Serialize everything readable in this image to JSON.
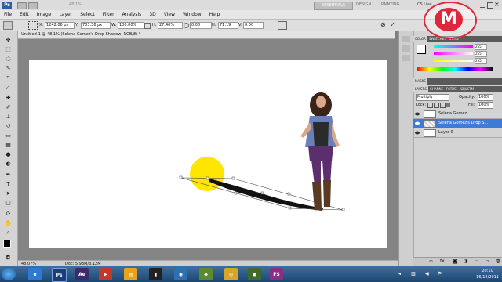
{
  "app": {
    "logo": "Ps",
    "zoom_value": "48.1%"
  },
  "workspace": {
    "essentials": "ESSENTIALS",
    "design": "DESIGN",
    "painting": "PAINTING",
    "cs_live": "CS Live"
  },
  "menu": [
    "File",
    "Edit",
    "Image",
    "Layer",
    "Select",
    "Filter",
    "Analysis",
    "3D",
    "View",
    "Window",
    "Help"
  ],
  "options": {
    "x_label": "X:",
    "x_value": "1242.06 px",
    "y_label": "Y:",
    "y_value": "783.38 px",
    "w_label": "W:",
    "w_value": "100.00%",
    "h_label": "H:",
    "h_value": "27.46%",
    "angle_value": "0.00",
    "h2_label": "H:",
    "h2_value": "71.19",
    "v_label": "V:",
    "v_value": "0.00"
  },
  "document": {
    "title": "Untitled-1 @ 48.1% (Selena Gomez's Drop Shadow, RGB/8) *"
  },
  "status": {
    "zoom": "48.07%",
    "doc": "Doc: 5.93M/3.12M"
  },
  "panels": {
    "color_tabs": [
      "COLOR",
      "SWATCHES",
      "STYLE"
    ],
    "color_values": [
      "255",
      "255",
      "255"
    ],
    "masks_tab": "MASKS",
    "layers_tabs": [
      "LAYERS",
      "CHANNE",
      "PATHS",
      "ADJUSTM"
    ],
    "blend_mode": "Multiply",
    "opacity_label": "Opacity:",
    "opacity_value": "100%",
    "lock_label": "Lock:",
    "fill_label": "Fill:",
    "fill_value": "100%",
    "layers": [
      {
        "name": "Selena Gomez"
      },
      {
        "name": "Selena Gomez's Drop S..."
      },
      {
        "name": "Layer 0"
      }
    ]
  },
  "watermark": {
    "letter": "M"
  },
  "clock": {
    "time": "20:10",
    "date": "16/12/2011"
  },
  "colors": {
    "highlight_yellow": "#ffe600",
    "selected_layer": "#3d7bd6",
    "watermark": "#e0263a"
  }
}
